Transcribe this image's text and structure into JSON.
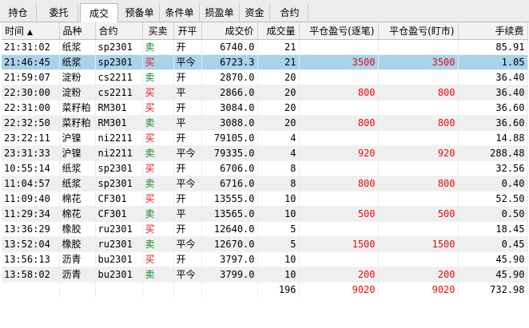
{
  "tabs": [
    "持仓",
    "委托",
    "成交",
    "预备单",
    "条件单",
    "损盈单",
    "资金",
    "合约"
  ],
  "active_tab": "成交",
  "columns": {
    "time": "时间",
    "sort_icon": "▲",
    "variety": "品种",
    "contract": "合约",
    "direction": "买卖",
    "openclose": "开平",
    "price": "成交价",
    "volume": "成交量",
    "pnl_fifo": "平仓盈亏(逐笔)",
    "pnl_mark": "平仓盈亏(盯市)",
    "fee": "手续费"
  },
  "rows": [
    {
      "time": "21:31:02",
      "variety": "纸浆",
      "contract": "sp2301",
      "dir": "卖",
      "oc": "开",
      "price": "6740.0",
      "vol": "21",
      "pnl1": "",
      "pnl2": "",
      "fee": "85.91"
    },
    {
      "time": "21:46:45",
      "variety": "纸浆",
      "contract": "sp2301",
      "dir": "买",
      "oc": "平今",
      "price": "6723.3",
      "vol": "21",
      "pnl1": "3500",
      "pnl2": "3500",
      "fee": "1.05"
    },
    {
      "time": "21:59:07",
      "variety": "淀粉",
      "contract": "cs2211",
      "dir": "卖",
      "oc": "开",
      "price": "2870.0",
      "vol": "20",
      "pnl1": "",
      "pnl2": "",
      "fee": "36.40"
    },
    {
      "time": "22:30:00",
      "variety": "淀粉",
      "contract": "cs2211",
      "dir": "买",
      "oc": "平",
      "price": "2866.0",
      "vol": "20",
      "pnl1": "800",
      "pnl2": "800",
      "fee": "36.40"
    },
    {
      "time": "22:31:00",
      "variety": "菜籽粕",
      "contract": "RM301",
      "dir": "买",
      "oc": "开",
      "price": "3084.0",
      "vol": "20",
      "pnl1": "",
      "pnl2": "",
      "fee": "36.60"
    },
    {
      "time": "22:32:50",
      "variety": "菜籽粕",
      "contract": "RM301",
      "dir": "卖",
      "oc": "平",
      "price": "3088.0",
      "vol": "20",
      "pnl1": "800",
      "pnl2": "800",
      "fee": "36.60"
    },
    {
      "time": "23:22:11",
      "variety": "沪镍",
      "contract": "ni2211",
      "dir": "买",
      "oc": "开",
      "price": "79105.0",
      "vol": "4",
      "pnl1": "",
      "pnl2": "",
      "fee": "14.88"
    },
    {
      "time": "23:31:33",
      "variety": "沪镍",
      "contract": "ni2211",
      "dir": "卖",
      "oc": "平今",
      "price": "79335.0",
      "vol": "4",
      "pnl1": "920",
      "pnl2": "920",
      "fee": "288.48"
    },
    {
      "time": "10:55:14",
      "variety": "纸浆",
      "contract": "sp2301",
      "dir": "买",
      "oc": "开",
      "price": "6706.0",
      "vol": "8",
      "pnl1": "",
      "pnl2": "",
      "fee": "32.56"
    },
    {
      "time": "11:04:57",
      "variety": "纸浆",
      "contract": "sp2301",
      "dir": "卖",
      "oc": "平今",
      "price": "6716.0",
      "vol": "8",
      "pnl1": "800",
      "pnl2": "800",
      "fee": "0.40"
    },
    {
      "time": "11:09:40",
      "variety": "棉花",
      "contract": "CF301",
      "dir": "买",
      "oc": "开",
      "price": "13555.0",
      "vol": "10",
      "pnl1": "",
      "pnl2": "",
      "fee": "52.50"
    },
    {
      "time": "11:29:34",
      "variety": "棉花",
      "contract": "CF301",
      "dir": "卖",
      "oc": "平",
      "price": "13565.0",
      "vol": "10",
      "pnl1": "500",
      "pnl2": "500",
      "fee": "0.50"
    },
    {
      "time": "13:36:29",
      "variety": "橡胶",
      "contract": "ru2301",
      "dir": "买",
      "oc": "开",
      "price": "12640.0",
      "vol": "5",
      "pnl1": "",
      "pnl2": "",
      "fee": "18.45"
    },
    {
      "time": "13:52:04",
      "variety": "橡胶",
      "contract": "ru2301",
      "dir": "卖",
      "oc": "平今",
      "price": "12670.0",
      "vol": "5",
      "pnl1": "1500",
      "pnl2": "1500",
      "fee": "0.45"
    },
    {
      "time": "13:56:13",
      "variety": "沥青",
      "contract": "bu2301",
      "dir": "买",
      "oc": "开",
      "price": "3797.0",
      "vol": "10",
      "pnl1": "",
      "pnl2": "",
      "fee": "45.90"
    },
    {
      "time": "13:58:02",
      "variety": "沥青",
      "contract": "bu2301",
      "dir": "卖",
      "oc": "平今",
      "price": "3799.0",
      "vol": "10",
      "pnl1": "200",
      "pnl2": "200",
      "fee": "45.90"
    }
  ],
  "selected_row": 1,
  "totals": {
    "vol": "196",
    "pnl1": "9020",
    "pnl2": "9020",
    "fee": "732.98"
  }
}
